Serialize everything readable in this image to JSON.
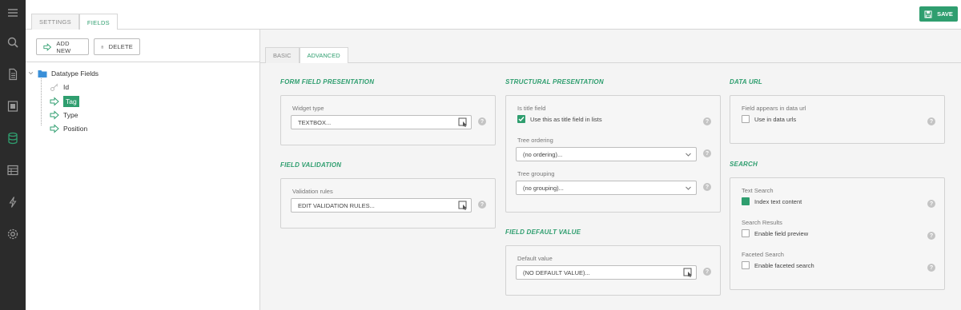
{
  "top_tabs": [
    "SETTINGS",
    "FIELDS"
  ],
  "save_label": "SAVE",
  "left_toolbar": {
    "add_new": "ADD NEW",
    "delete": "DELETE"
  },
  "tree": {
    "root": "Datatype Fields",
    "children": [
      "Id",
      "Tag",
      "Type",
      "Position"
    ],
    "selected": "Tag"
  },
  "sub_tabs": [
    "BASIC",
    "ADVANCED"
  ],
  "sections": {
    "form_field": {
      "title": "FORM FIELD PRESENTATION",
      "widget_label": "Widget type",
      "widget_value": "TEXTBOX..."
    },
    "validation": {
      "title": "FIELD VALIDATION",
      "rules_label": "Validation rules",
      "rules_value": "EDIT VALIDATION RULES..."
    },
    "structural": {
      "title": "STRUCTURAL PRESENTATION",
      "title_field_label": "Is title field",
      "title_field_check": "Use this as title field in lists",
      "tree_ordering_label": "Tree ordering",
      "tree_ordering_value": "(no ordering)...",
      "tree_grouping_label": "Tree grouping",
      "tree_grouping_value": "(no grouping)..."
    },
    "default_value": {
      "title": "FIELD DEFAULT VALUE",
      "label": "Default value",
      "value": "(NO DEFAULT VALUE)..."
    },
    "data_url": {
      "title": "DATA URL",
      "label": "Field appears in data url",
      "check": "Use in data urls"
    },
    "search": {
      "title": "SEARCH",
      "text_search_label": "Text Search",
      "text_search_check": "Index text content",
      "results_label": "Search Results",
      "results_check": "Enable field preview",
      "faceted_label": "Faceted Search",
      "faceted_check": "Enable faceted search"
    }
  },
  "help_glyph": "?",
  "colors": {
    "accent": "#2f9e6f",
    "rail": "#2b2b2b",
    "panel": "#f6f6f6"
  },
  "icons": [
    "menu-icon",
    "search-icon",
    "document-icon",
    "media-icon",
    "database-icon",
    "table-icon",
    "lightning-icon",
    "gear-icon"
  ]
}
